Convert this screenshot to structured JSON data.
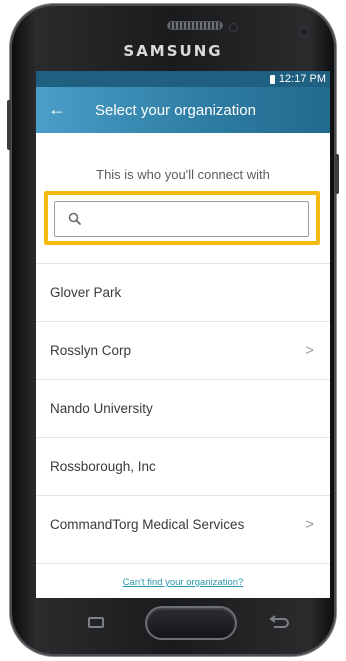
{
  "device": {
    "brand": "SAMSUNG"
  },
  "statusbar": {
    "time": "12:17 PM"
  },
  "appbar": {
    "back_icon": "arrow-left-icon",
    "title": "Select your organization"
  },
  "main": {
    "subtitle": "This is who you'll connect with",
    "search": {
      "icon": "search-icon",
      "value": "",
      "placeholder": ""
    },
    "organizations": [
      {
        "label": "Glover Park",
        "has_chevron": false
      },
      {
        "label": "Rosslyn Corp",
        "has_chevron": true
      },
      {
        "label": "Nando University",
        "has_chevron": false
      },
      {
        "label": "Rossborough, Inc",
        "has_chevron": false
      },
      {
        "label": "CommandTorg Medical Services",
        "has_chevron": true
      }
    ],
    "cant_find_link": "Can't find your organization?"
  },
  "colors": {
    "appbar_start": "#4a9ec8",
    "appbar_end": "#226a8e",
    "highlight": "#f5b914",
    "link": "#2a98b0"
  }
}
